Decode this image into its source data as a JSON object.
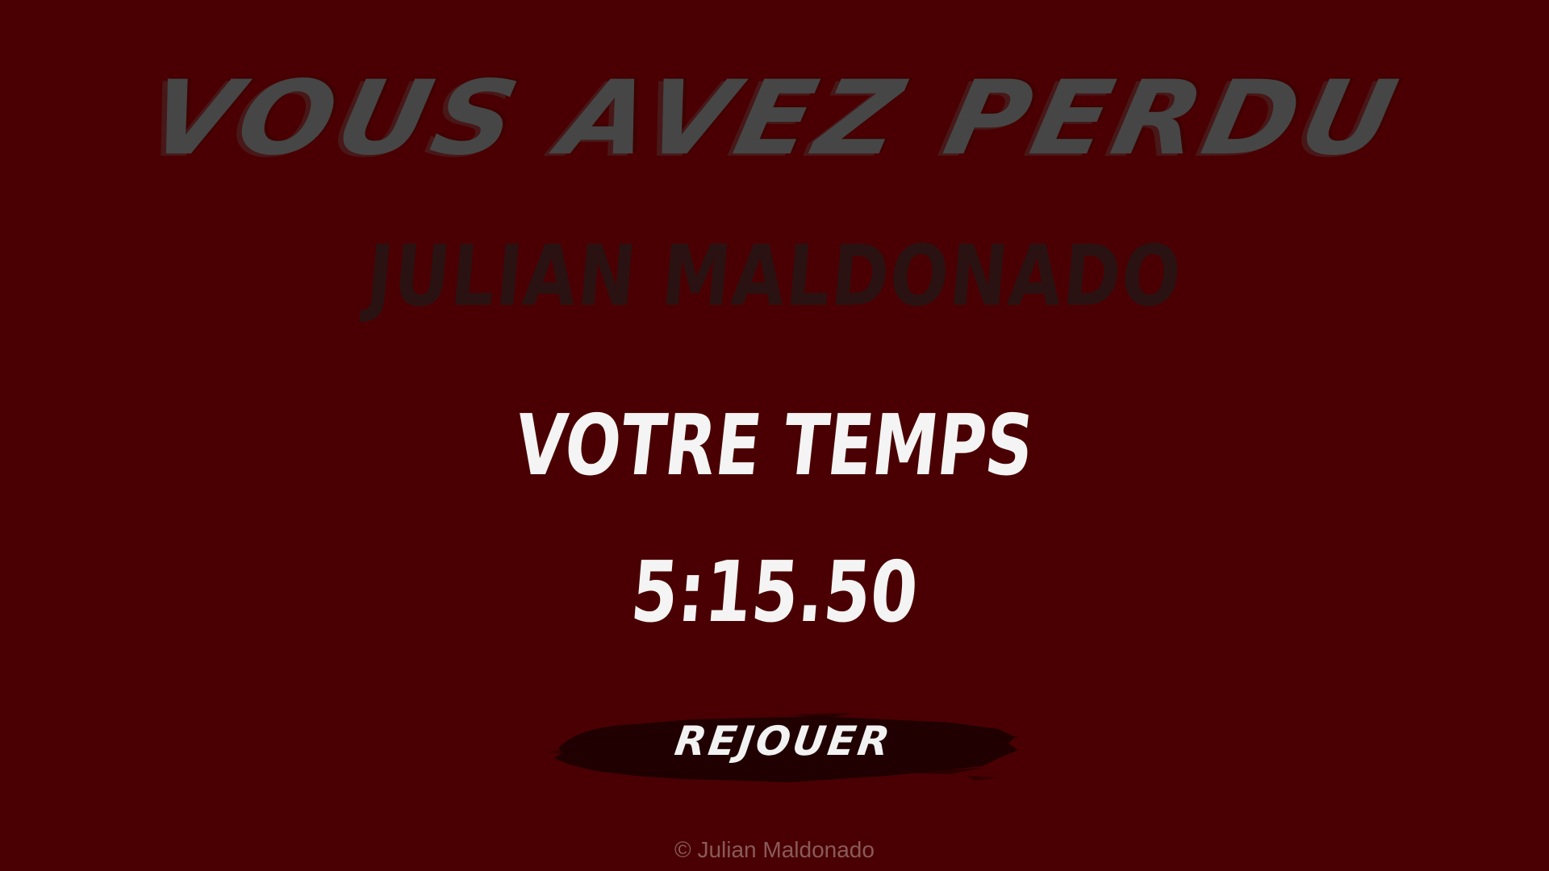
{
  "screen": {
    "title": "VOUS AVEZ PERDU",
    "player_name": "JULIAN MALDONADO",
    "time_label": "VOTRE TEMPS",
    "time_value": "5:15.50",
    "replay_label": "REJOUER",
    "copyright": "© Julian Maldonado"
  },
  "colors": {
    "background": "#4a0002",
    "title": "#464646",
    "player_name": "#2a1212",
    "time_text": "#f4f4f4",
    "button_brush": "#1e0000",
    "copyright": "#8a5a5a"
  }
}
